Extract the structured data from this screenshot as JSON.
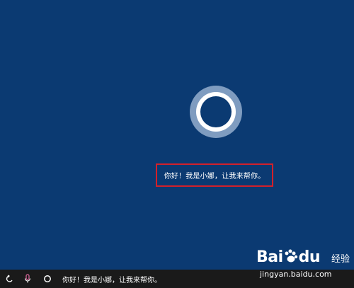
{
  "greeting": {
    "text": "你好！我是小娜，让我来帮你。"
  },
  "taskbar": {
    "icons": [
      "back-arrow-icon",
      "microphone-icon",
      "cortana-circle-icon"
    ],
    "text": "你好！我是小娜，让我来帮你。"
  },
  "watermark": {
    "brand_prefix": "Bai",
    "brand_suffix": "du",
    "brand_cn": "经验",
    "url": "jingyan.baidu.com"
  },
  "colors": {
    "background": "#0b3a72",
    "ring_outer": "#7f9cc0",
    "highlight_border": "#d3202a",
    "taskbar": "#1a1a1a"
  }
}
